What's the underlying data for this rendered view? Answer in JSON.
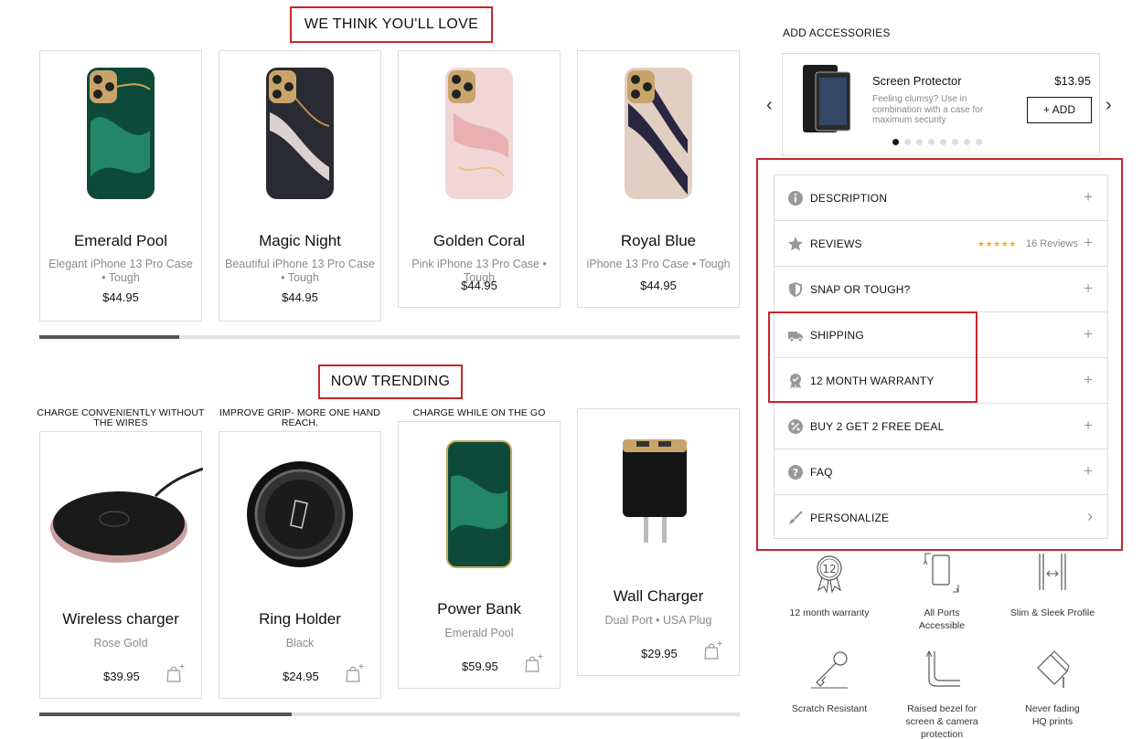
{
  "sections": {
    "recommended_title": "WE THINK YOU'LL LOVE",
    "trending_title": "NOW TRENDING"
  },
  "recommended": [
    {
      "name": "Emerald Pool",
      "sub": "Elegant iPhone 13 Pro Case • Tough",
      "price": "$44.95",
      "case_color": "#0e4a3a",
      "accent": "#2ba07a"
    },
    {
      "name": "Magic Night",
      "sub": "Beautiful iPhone 13 Pro Case • Tough",
      "price": "$44.95",
      "case_color": "#2a2a33",
      "accent": "#d9d2cf"
    },
    {
      "name": "Golden Coral",
      "sub": "Pink iPhone 13 Pro Case • Tough",
      "price": "$44.95",
      "case_color": "#f1d6d6",
      "accent": "#e8a6a8"
    },
    {
      "name": "Royal Blue",
      "sub": "iPhone 13 Pro Case • Tough",
      "price": "$44.95",
      "case_color": "#2a2540",
      "accent": "#e2cfc4"
    }
  ],
  "trending": [
    {
      "tagline": "CHARGE CONVENIENTLY WITHOUT THE WIRES",
      "name": "Wireless charger",
      "sub": "Rose Gold",
      "price": "$39.95"
    },
    {
      "tagline": "IMPROVE GRIP- MORE ONE HAND REACH.",
      "name": "Ring Holder",
      "sub": "Black",
      "price": "$24.95"
    },
    {
      "tagline": "CHARGE WHILE ON THE GO",
      "name": "Power Bank",
      "sub": "Emerald Pool",
      "price": "$59.95"
    },
    {
      "tagline": "",
      "name": "Wall Charger",
      "sub": "Dual Port • USA Plug",
      "price": "$29.95"
    }
  ],
  "recommended_scroll": 0.2,
  "trending_scroll": 0.36,
  "accessories": {
    "title": "ADD ACCESSORIES",
    "item_name": "Screen Protector",
    "item_price": "$13.95",
    "item_desc": "Feeling clumsy? Use in combination with a case for maximum security",
    "add_label": "+ ADD",
    "active_dot": 0,
    "dot_count": 8
  },
  "accordion": [
    {
      "label": "DESCRIPTION",
      "icon": "info-icon",
      "indicator": "+"
    },
    {
      "label": "REVIEWS",
      "icon": "star-icon",
      "indicator": "+",
      "stars": "★★★★★",
      "reviews": "16 Reviews"
    },
    {
      "label": "SNAP OR TOUGH?",
      "icon": "shield-icon",
      "indicator": "+"
    },
    {
      "label": "SHIPPING",
      "icon": "truck-icon",
      "indicator": "+"
    },
    {
      "label": "12 MONTH WARRANTY",
      "icon": "badge-icon",
      "indicator": "+"
    },
    {
      "label": "BUY 2 GET 2 FREE DEAL",
      "icon": "percent-icon",
      "indicator": "+"
    },
    {
      "label": "FAQ",
      "icon": "question-icon",
      "indicator": "+"
    },
    {
      "label": "PERSONALIZE",
      "icon": "brush-icon",
      "indicator": "›"
    }
  ],
  "features": [
    {
      "label": "12 month warranty",
      "icon": "warranty-12-icon"
    },
    {
      "label": "All Ports Accessible",
      "icon": "ports-icon"
    },
    {
      "label": "Slim & Sleek Profile",
      "icon": "slim-profile-icon"
    },
    {
      "label": "Scratch Resistant",
      "icon": "scratch-icon"
    },
    {
      "label": "Raised bezel for screen & camera protection",
      "icon": "bezel-icon"
    },
    {
      "label": "Never fading HQ prints",
      "icon": "print-icon"
    }
  ],
  "colors": {
    "highlight": "#c8252b",
    "star": "#f2b01e"
  }
}
